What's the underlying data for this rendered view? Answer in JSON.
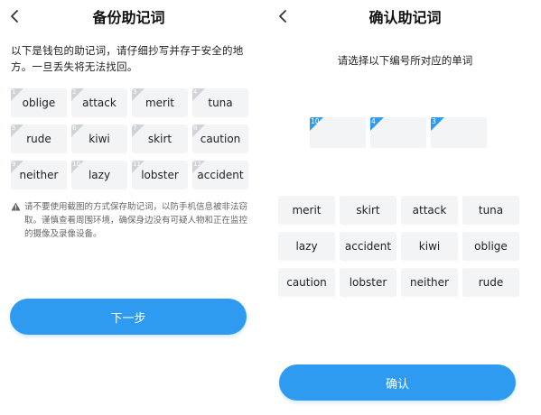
{
  "backup": {
    "title": "备份助记词",
    "intro": "以下是钱包的助记词，请仔细抄写并存于安全的地方。一旦丢失将无法找回。",
    "words": [
      {
        "num": "1",
        "word": "oblige"
      },
      {
        "num": "2",
        "word": "attack"
      },
      {
        "num": "3",
        "word": "merit"
      },
      {
        "num": "4",
        "word": "tuna"
      },
      {
        "num": "5",
        "word": "rude"
      },
      {
        "num": "6",
        "word": "kiwi"
      },
      {
        "num": "7",
        "word": "skirt"
      },
      {
        "num": "8",
        "word": "caution"
      },
      {
        "num": "9",
        "word": "neither"
      },
      {
        "num": "10",
        "word": "lazy"
      },
      {
        "num": "11",
        "word": "lobster"
      },
      {
        "num": "12",
        "word": "accident"
      }
    ],
    "warning": "请不要使用截图的方式保存助记词，以防手机信息被非法窃取。谨慎查看周围环境，确保身边没有可疑人物和正在监控的摄像及录像设备。",
    "next_label": "下一步"
  },
  "confirm": {
    "title": "确认助记词",
    "subtitle": "请选择以下编号所对应的单词",
    "slots": [
      {
        "num": "10"
      },
      {
        "num": "4"
      },
      {
        "num": "3"
      }
    ],
    "choices": [
      "merit",
      "skirt",
      "attack",
      "tuna",
      "lazy",
      "accident",
      "kiwi",
      "oblige",
      "caution",
      "lobster",
      "neither",
      "rude"
    ],
    "confirm_label": "确认"
  },
  "colors": {
    "accent": "#2f9bf0",
    "cell_bg": "#f3f4f6",
    "corner_gray": "#cfd2d6"
  },
  "icons": {
    "back": "chevron-left-icon",
    "warning": "warning-triangle-icon"
  }
}
